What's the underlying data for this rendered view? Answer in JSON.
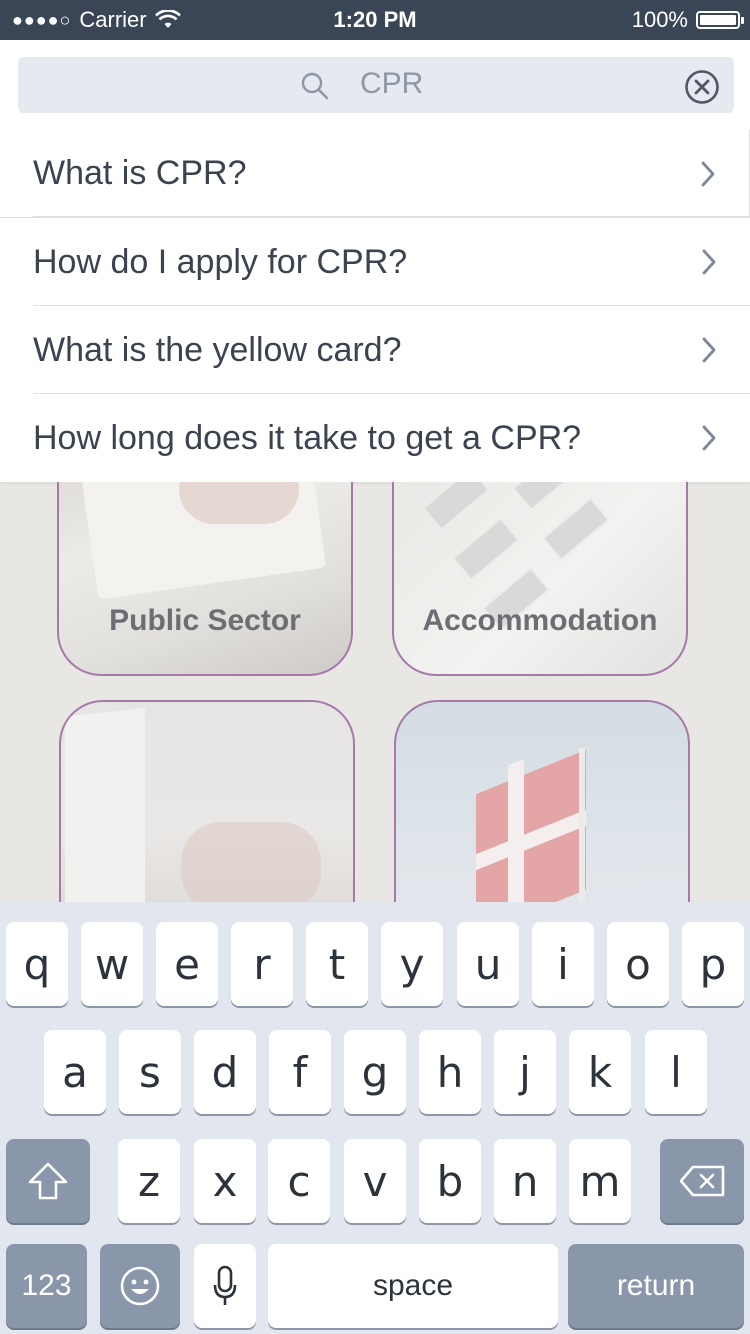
{
  "status_bar": {
    "signal": "●●●●○",
    "carrier": "Carrier",
    "time": "1:20 PM",
    "battery_text": "100%",
    "battery_level": 1.0
  },
  "search": {
    "query": "CPR",
    "icons": {
      "left": "search-icon",
      "right": "clear-icon"
    }
  },
  "results": [
    {
      "label": "What is CPR?"
    },
    {
      "label": "How do I apply for CPR?"
    },
    {
      "label": "What is the yellow card?"
    },
    {
      "label": "How long does it take to get a CPR?"
    }
  ],
  "tiles": [
    {
      "caption": "Public Sector"
    },
    {
      "caption": "Accommodation"
    },
    {
      "caption": ""
    },
    {
      "caption": ""
    }
  ],
  "keyboard": {
    "row1": [
      "q",
      "w",
      "e",
      "r",
      "t",
      "y",
      "u",
      "i",
      "o",
      "p"
    ],
    "row2": [
      "a",
      "s",
      "d",
      "f",
      "g",
      "h",
      "j",
      "k",
      "l"
    ],
    "row3": [
      "z",
      "x",
      "c",
      "v",
      "b",
      "n",
      "m"
    ],
    "numbers_label": "123",
    "space_label": "space",
    "return_label": "return",
    "icons": {
      "shift": "shift-icon",
      "delete": "backspace-icon",
      "emoji": "emoji-icon",
      "mic": "microphone-icon"
    }
  },
  "colors": {
    "status_bar": "#3a4656",
    "accent_tile_border": "#a579a8",
    "keyboard_bg": "#e2e6ef",
    "dark_key": "#8a96aa"
  }
}
